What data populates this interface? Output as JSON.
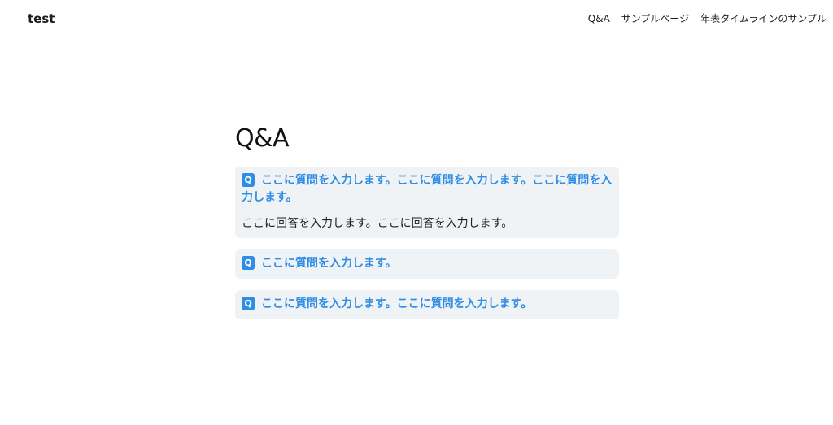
{
  "header": {
    "site_title": "test",
    "nav": [
      "Q&A",
      "サンプルページ",
      "年表タイムラインのサンプル"
    ]
  },
  "main": {
    "title": "Q&A",
    "badge": "Q",
    "faqs": [
      {
        "question": "ここに質問を入力します。ここに質問を入力します。ここに質問を入力します。",
        "answer": "ここに回答を入力します。ここに回答を入力します。"
      },
      {
        "question": "ここに質問を入力します。"
      },
      {
        "question": "ここに質問を入力します。ここに質問を入力します。"
      }
    ]
  },
  "colors": {
    "accent": "#2f8de4",
    "card_background": "#f0f3f6"
  }
}
